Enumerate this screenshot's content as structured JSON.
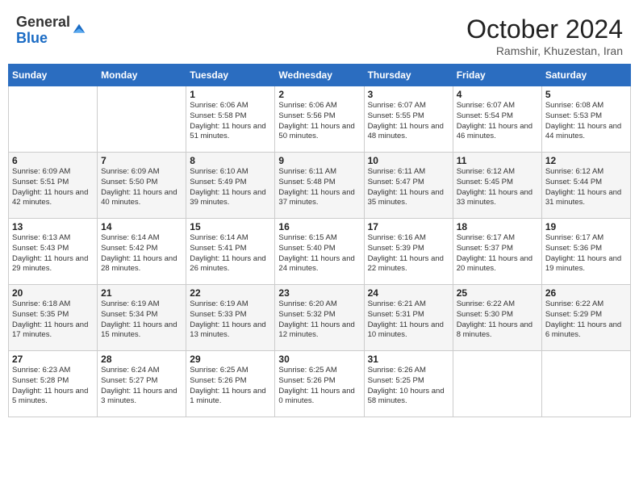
{
  "header": {
    "logo_general": "General",
    "logo_blue": "Blue",
    "month": "October 2024",
    "location": "Ramshir, Khuzestan, Iran"
  },
  "weekdays": [
    "Sunday",
    "Monday",
    "Tuesday",
    "Wednesday",
    "Thursday",
    "Friday",
    "Saturday"
  ],
  "weeks": [
    [
      {
        "day": "",
        "sunrise": "",
        "sunset": "",
        "daylight": ""
      },
      {
        "day": "",
        "sunrise": "",
        "sunset": "",
        "daylight": ""
      },
      {
        "day": "1",
        "sunrise": "Sunrise: 6:06 AM",
        "sunset": "Sunset: 5:58 PM",
        "daylight": "Daylight: 11 hours and 51 minutes."
      },
      {
        "day": "2",
        "sunrise": "Sunrise: 6:06 AM",
        "sunset": "Sunset: 5:56 PM",
        "daylight": "Daylight: 11 hours and 50 minutes."
      },
      {
        "day": "3",
        "sunrise": "Sunrise: 6:07 AM",
        "sunset": "Sunset: 5:55 PM",
        "daylight": "Daylight: 11 hours and 48 minutes."
      },
      {
        "day": "4",
        "sunrise": "Sunrise: 6:07 AM",
        "sunset": "Sunset: 5:54 PM",
        "daylight": "Daylight: 11 hours and 46 minutes."
      },
      {
        "day": "5",
        "sunrise": "Sunrise: 6:08 AM",
        "sunset": "Sunset: 5:53 PM",
        "daylight": "Daylight: 11 hours and 44 minutes."
      }
    ],
    [
      {
        "day": "6",
        "sunrise": "Sunrise: 6:09 AM",
        "sunset": "Sunset: 5:51 PM",
        "daylight": "Daylight: 11 hours and 42 minutes."
      },
      {
        "day": "7",
        "sunrise": "Sunrise: 6:09 AM",
        "sunset": "Sunset: 5:50 PM",
        "daylight": "Daylight: 11 hours and 40 minutes."
      },
      {
        "day": "8",
        "sunrise": "Sunrise: 6:10 AM",
        "sunset": "Sunset: 5:49 PM",
        "daylight": "Daylight: 11 hours and 39 minutes."
      },
      {
        "day": "9",
        "sunrise": "Sunrise: 6:11 AM",
        "sunset": "Sunset: 5:48 PM",
        "daylight": "Daylight: 11 hours and 37 minutes."
      },
      {
        "day": "10",
        "sunrise": "Sunrise: 6:11 AM",
        "sunset": "Sunset: 5:47 PM",
        "daylight": "Daylight: 11 hours and 35 minutes."
      },
      {
        "day": "11",
        "sunrise": "Sunrise: 6:12 AM",
        "sunset": "Sunset: 5:45 PM",
        "daylight": "Daylight: 11 hours and 33 minutes."
      },
      {
        "day": "12",
        "sunrise": "Sunrise: 6:12 AM",
        "sunset": "Sunset: 5:44 PM",
        "daylight": "Daylight: 11 hours and 31 minutes."
      }
    ],
    [
      {
        "day": "13",
        "sunrise": "Sunrise: 6:13 AM",
        "sunset": "Sunset: 5:43 PM",
        "daylight": "Daylight: 11 hours and 29 minutes."
      },
      {
        "day": "14",
        "sunrise": "Sunrise: 6:14 AM",
        "sunset": "Sunset: 5:42 PM",
        "daylight": "Daylight: 11 hours and 28 minutes."
      },
      {
        "day": "15",
        "sunrise": "Sunrise: 6:14 AM",
        "sunset": "Sunset: 5:41 PM",
        "daylight": "Daylight: 11 hours and 26 minutes."
      },
      {
        "day": "16",
        "sunrise": "Sunrise: 6:15 AM",
        "sunset": "Sunset: 5:40 PM",
        "daylight": "Daylight: 11 hours and 24 minutes."
      },
      {
        "day": "17",
        "sunrise": "Sunrise: 6:16 AM",
        "sunset": "Sunset: 5:39 PM",
        "daylight": "Daylight: 11 hours and 22 minutes."
      },
      {
        "day": "18",
        "sunrise": "Sunrise: 6:17 AM",
        "sunset": "Sunset: 5:37 PM",
        "daylight": "Daylight: 11 hours and 20 minutes."
      },
      {
        "day": "19",
        "sunrise": "Sunrise: 6:17 AM",
        "sunset": "Sunset: 5:36 PM",
        "daylight": "Daylight: 11 hours and 19 minutes."
      }
    ],
    [
      {
        "day": "20",
        "sunrise": "Sunrise: 6:18 AM",
        "sunset": "Sunset: 5:35 PM",
        "daylight": "Daylight: 11 hours and 17 minutes."
      },
      {
        "day": "21",
        "sunrise": "Sunrise: 6:19 AM",
        "sunset": "Sunset: 5:34 PM",
        "daylight": "Daylight: 11 hours and 15 minutes."
      },
      {
        "day": "22",
        "sunrise": "Sunrise: 6:19 AM",
        "sunset": "Sunset: 5:33 PM",
        "daylight": "Daylight: 11 hours and 13 minutes."
      },
      {
        "day": "23",
        "sunrise": "Sunrise: 6:20 AM",
        "sunset": "Sunset: 5:32 PM",
        "daylight": "Daylight: 11 hours and 12 minutes."
      },
      {
        "day": "24",
        "sunrise": "Sunrise: 6:21 AM",
        "sunset": "Sunset: 5:31 PM",
        "daylight": "Daylight: 11 hours and 10 minutes."
      },
      {
        "day": "25",
        "sunrise": "Sunrise: 6:22 AM",
        "sunset": "Sunset: 5:30 PM",
        "daylight": "Daylight: 11 hours and 8 minutes."
      },
      {
        "day": "26",
        "sunrise": "Sunrise: 6:22 AM",
        "sunset": "Sunset: 5:29 PM",
        "daylight": "Daylight: 11 hours and 6 minutes."
      }
    ],
    [
      {
        "day": "27",
        "sunrise": "Sunrise: 6:23 AM",
        "sunset": "Sunset: 5:28 PM",
        "daylight": "Daylight: 11 hours and 5 minutes."
      },
      {
        "day": "28",
        "sunrise": "Sunrise: 6:24 AM",
        "sunset": "Sunset: 5:27 PM",
        "daylight": "Daylight: 11 hours and 3 minutes."
      },
      {
        "day": "29",
        "sunrise": "Sunrise: 6:25 AM",
        "sunset": "Sunset: 5:26 PM",
        "daylight": "Daylight: 11 hours and 1 minute."
      },
      {
        "day": "30",
        "sunrise": "Sunrise: 6:25 AM",
        "sunset": "Sunset: 5:26 PM",
        "daylight": "Daylight: 11 hours and 0 minutes."
      },
      {
        "day": "31",
        "sunrise": "Sunrise: 6:26 AM",
        "sunset": "Sunset: 5:25 PM",
        "daylight": "Daylight: 10 hours and 58 minutes."
      },
      {
        "day": "",
        "sunrise": "",
        "sunset": "",
        "daylight": ""
      },
      {
        "day": "",
        "sunrise": "",
        "sunset": "",
        "daylight": ""
      }
    ]
  ]
}
